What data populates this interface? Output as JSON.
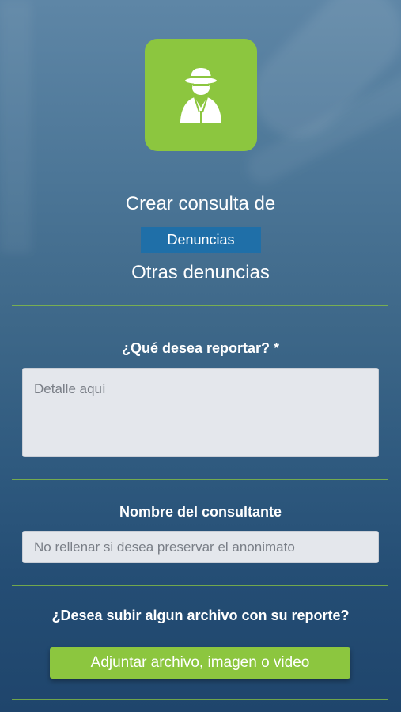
{
  "app": {
    "logo_icon": "anonymous-detective-icon",
    "accent_color": "#8cc63f",
    "badge_color": "#1f6fa8"
  },
  "header": {
    "title": "Crear consulta de",
    "category": "Denuncias",
    "subcategory": "Otras denuncias"
  },
  "form": {
    "report": {
      "label": "¿Qué desea reportar? *",
      "placeholder": "Detalle aquí",
      "value": ""
    },
    "name": {
      "label": "Nombre del consultante",
      "placeholder": "No rellenar si desea preservar el anonimato",
      "value": ""
    },
    "attachment": {
      "question": "¿Desea subir algun archivo con su reporte?",
      "button_label": "Adjuntar archivo, imagen o video"
    }
  }
}
